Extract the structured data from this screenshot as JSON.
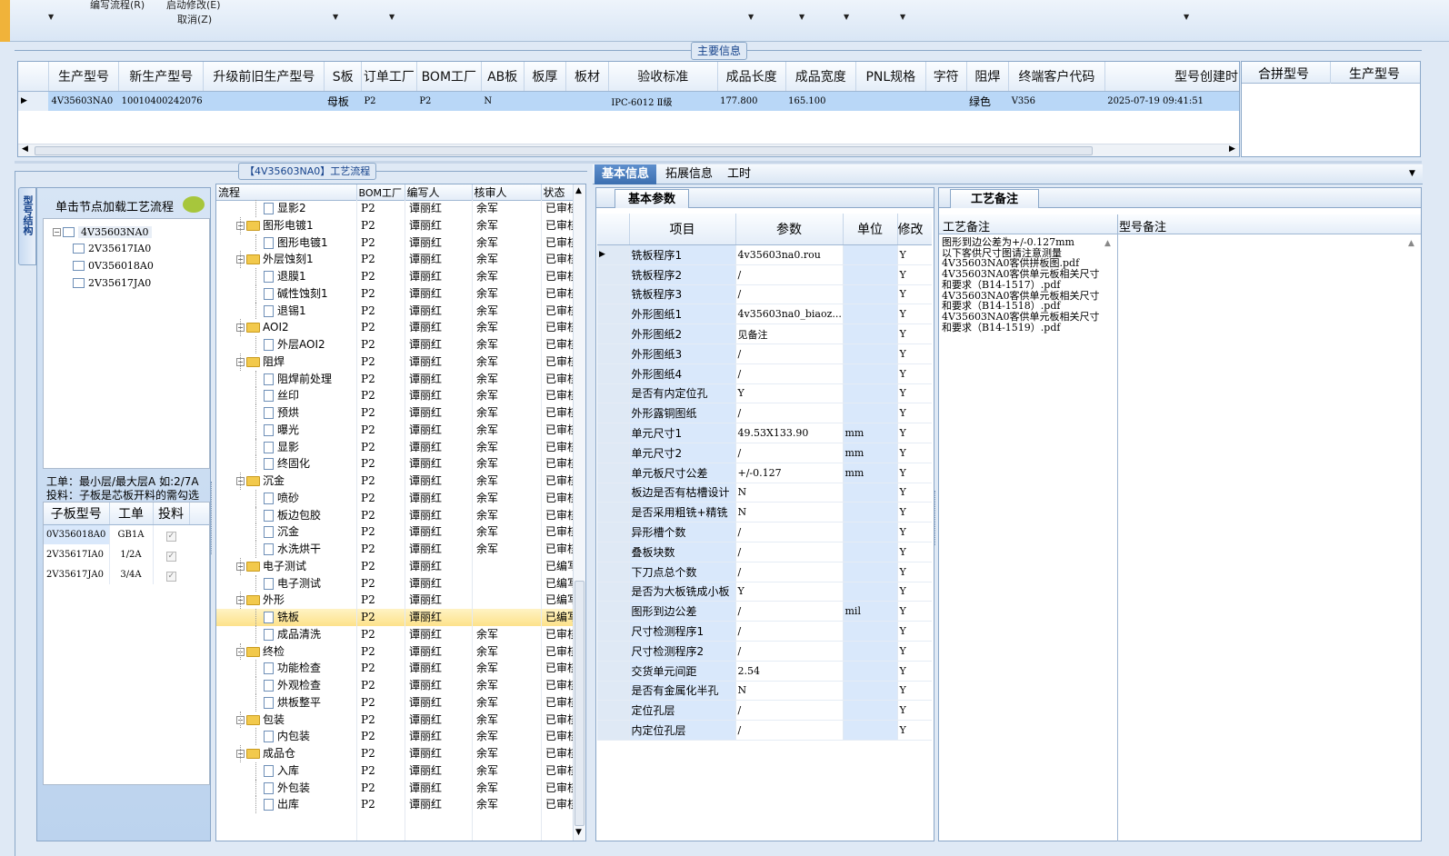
{
  "toolbar": {
    "item1": "编写流程(R)",
    "item2": "启动修改(E)",
    "item3": "取消(Z)"
  },
  "main_info": {
    "title": "主要信息",
    "columns": [
      "生产型号",
      "新生产型号",
      "升级前旧生产型号",
      "S板",
      "订单工厂",
      "BOM工厂",
      "AB板",
      "板厚",
      "板材",
      "验收标准",
      "成品长度",
      "成品宽度",
      "PNL规格",
      "字符",
      "阻焊",
      "终端客户代码",
      "型号创建时"
    ],
    "row": [
      "4V35603NA0",
      "10010400242076",
      "",
      "母板",
      "P2",
      "P2",
      "N",
      "",
      "",
      "IPC-6012 Ⅱ级",
      "177.800",
      "165.100",
      "",
      "",
      "绿色",
      "V356",
      "2025-07-19 09:41:51"
    ],
    "merge_columns": [
      "合拼型号",
      "生产型号"
    ]
  },
  "left_panel": {
    "side_tab": "型号结构",
    "load_hint": "单击节点加载工艺流程",
    "tree": {
      "root": "4V35603NA0",
      "children": [
        "2V35617IA0",
        "0V356018A0",
        "2V35617JA0"
      ]
    },
    "note1": "工单：最小层/最大层A 如:2/7A",
    "note2": "投料：子板是芯板开料的需勾选",
    "sub_columns": [
      "子板型号",
      "工单",
      "投料"
    ],
    "sub_rows": [
      [
        "0V356018A0",
        "GB1A",
        "✓"
      ],
      [
        "2V35617IA0",
        "1/2A",
        "✓"
      ],
      [
        "2V35617JA0",
        "3/4A",
        "✓"
      ]
    ]
  },
  "flow": {
    "title": "【4V35603NA0】工艺流程",
    "columns": [
      "流程",
      "BOM工厂",
      "编写人",
      "核审人",
      "状态"
    ],
    "rows": [
      {
        "level": 2,
        "name": "显影2",
        "bom": "P2",
        "writer": "谭丽红",
        "reviewer": "余军",
        "status": "已审核"
      },
      {
        "level": 1,
        "name": "图形电镀1",
        "bom": "P2",
        "writer": "谭丽红",
        "reviewer": "余军",
        "status": "已审核"
      },
      {
        "level": 2,
        "name": "图形电镀1",
        "bom": "P2",
        "writer": "谭丽红",
        "reviewer": "余军",
        "status": "已审核"
      },
      {
        "level": 1,
        "name": "外层蚀刻1",
        "bom": "P2",
        "writer": "谭丽红",
        "reviewer": "余军",
        "status": "已审核"
      },
      {
        "level": 2,
        "name": "退膜1",
        "bom": "P2",
        "writer": "谭丽红",
        "reviewer": "余军",
        "status": "已审核"
      },
      {
        "level": 2,
        "name": "碱性蚀刻1",
        "bom": "P2",
        "writer": "谭丽红",
        "reviewer": "余军",
        "status": "已审核"
      },
      {
        "level": 2,
        "name": "退锡1",
        "bom": "P2",
        "writer": "谭丽红",
        "reviewer": "余军",
        "status": "已审核"
      },
      {
        "level": 1,
        "name": "AOI2",
        "bom": "P2",
        "writer": "谭丽红",
        "reviewer": "余军",
        "status": "已审核"
      },
      {
        "level": 2,
        "name": "外层AOI2",
        "bom": "P2",
        "writer": "谭丽红",
        "reviewer": "余军",
        "status": "已审核"
      },
      {
        "level": 1,
        "name": "阻焊",
        "bom": "P2",
        "writer": "谭丽红",
        "reviewer": "余军",
        "status": "已审核"
      },
      {
        "level": 2,
        "name": "阻焊前处理",
        "bom": "P2",
        "writer": "谭丽红",
        "reviewer": "余军",
        "status": "已审核"
      },
      {
        "level": 2,
        "name": "丝印",
        "bom": "P2",
        "writer": "谭丽红",
        "reviewer": "余军",
        "status": "已审核"
      },
      {
        "level": 2,
        "name": "预烘",
        "bom": "P2",
        "writer": "谭丽红",
        "reviewer": "余军",
        "status": "已审核"
      },
      {
        "level": 2,
        "name": "曝光",
        "bom": "P2",
        "writer": "谭丽红",
        "reviewer": "余军",
        "status": "已审核"
      },
      {
        "level": 2,
        "name": "显影",
        "bom": "P2",
        "writer": "谭丽红",
        "reviewer": "余军",
        "status": "已审核"
      },
      {
        "level": 2,
        "name": "终固化",
        "bom": "P2",
        "writer": "谭丽红",
        "reviewer": "余军",
        "status": "已审核"
      },
      {
        "level": 1,
        "name": "沉金",
        "bom": "P2",
        "writer": "谭丽红",
        "reviewer": "余军",
        "status": "已审核"
      },
      {
        "level": 2,
        "name": "喷砂",
        "bom": "P2",
        "writer": "谭丽红",
        "reviewer": "余军",
        "status": "已审核"
      },
      {
        "level": 2,
        "name": "板边包胶",
        "bom": "P2",
        "writer": "谭丽红",
        "reviewer": "余军",
        "status": "已审核"
      },
      {
        "level": 2,
        "name": "沉金",
        "bom": "P2",
        "writer": "谭丽红",
        "reviewer": "余军",
        "status": "已审核"
      },
      {
        "level": 2,
        "name": "水洗烘干",
        "bom": "P2",
        "writer": "谭丽红",
        "reviewer": "余军",
        "status": "已审核"
      },
      {
        "level": 1,
        "name": "电子测试",
        "bom": "P2",
        "writer": "谭丽红",
        "reviewer": "",
        "status": "已编写"
      },
      {
        "level": 2,
        "name": "电子测试",
        "bom": "P2",
        "writer": "谭丽红",
        "reviewer": "",
        "status": "已编写"
      },
      {
        "level": 1,
        "name": "外形",
        "bom": "P2",
        "writer": "谭丽红",
        "reviewer": "",
        "status": "已编写"
      },
      {
        "level": 2,
        "name": "铣板",
        "bom": "P2",
        "writer": "谭丽红",
        "reviewer": "",
        "status": "已编写",
        "selected": true
      },
      {
        "level": 2,
        "name": "成品清洗",
        "bom": "P2",
        "writer": "谭丽红",
        "reviewer": "余军",
        "status": "已审核"
      },
      {
        "level": 1,
        "name": "终检",
        "bom": "P2",
        "writer": "谭丽红",
        "reviewer": "余军",
        "status": "已审核"
      },
      {
        "level": 2,
        "name": "功能检查",
        "bom": "P2",
        "writer": "谭丽红",
        "reviewer": "余军",
        "status": "已审核"
      },
      {
        "level": 2,
        "name": "外观检查",
        "bom": "P2",
        "writer": "谭丽红",
        "reviewer": "余军",
        "status": "已审核"
      },
      {
        "level": 2,
        "name": "烘板整平",
        "bom": "P2",
        "writer": "谭丽红",
        "reviewer": "余军",
        "status": "已审核"
      },
      {
        "level": 1,
        "name": "包装",
        "bom": "P2",
        "writer": "谭丽红",
        "reviewer": "余军",
        "status": "已审核"
      },
      {
        "level": 2,
        "name": "内包装",
        "bom": "P2",
        "writer": "谭丽红",
        "reviewer": "余军",
        "status": "已审核"
      },
      {
        "level": 1,
        "name": "成品仓",
        "bom": "P2",
        "writer": "谭丽红",
        "reviewer": "余军",
        "status": "已审核"
      },
      {
        "level": 2,
        "name": "入库",
        "bom": "P2",
        "writer": "谭丽红",
        "reviewer": "余军",
        "status": "已审核"
      },
      {
        "level": 2,
        "name": "外包装",
        "bom": "P2",
        "writer": "谭丽红",
        "reviewer": "余军",
        "status": "已审核"
      },
      {
        "level": 2,
        "name": "出库",
        "bom": "P2",
        "writer": "谭丽红",
        "reviewer": "余军",
        "status": "已审核"
      }
    ]
  },
  "tabs": [
    "基本信息",
    "拓展信息",
    "工时"
  ],
  "params": {
    "title": "基本参数",
    "columns": [
      "项目",
      "参数",
      "单位",
      "修改"
    ],
    "rows": [
      [
        "铣板程序1",
        "4v35603na0.rou",
        "",
        "Y"
      ],
      [
        "铣板程序2",
        "/",
        "",
        "Y"
      ],
      [
        "铣板程序3",
        "/",
        "",
        "Y"
      ],
      [
        "外形图纸1",
        "4v35603na0_biaoz...",
        "",
        "Y"
      ],
      [
        "外形图纸2",
        "见备注",
        "",
        "Y"
      ],
      [
        "外形图纸3",
        "/",
        "",
        "Y"
      ],
      [
        "外形图纸4",
        "/",
        "",
        "Y"
      ],
      [
        "是否有内定位孔",
        "Y",
        "",
        "Y"
      ],
      [
        "外形露铜图纸",
        "/",
        "",
        "Y"
      ],
      [
        "单元尺寸1",
        "49.53X133.90",
        "mm",
        "Y"
      ],
      [
        "单元尺寸2",
        "/",
        "mm",
        "Y"
      ],
      [
        "单元板尺寸公差",
        "+/-0.127",
        "mm",
        "Y"
      ],
      [
        "板边是否有枯槽设计",
        "N",
        "",
        "Y"
      ],
      [
        "是否采用粗铣+精铣",
        "N",
        "",
        "Y"
      ],
      [
        "异形槽个数",
        "/",
        "",
        "Y"
      ],
      [
        "叠板块数",
        "/",
        "",
        "Y"
      ],
      [
        "下刀点总个数",
        "/",
        "",
        "Y"
      ],
      [
        "是否为大板铣成小板",
        "Y",
        "",
        "Y"
      ],
      [
        "图形到边公差",
        "/",
        "mil",
        "Y"
      ],
      [
        "尺寸检测程序1",
        "/",
        "",
        "Y"
      ],
      [
        "尺寸检测程序2",
        "/",
        "",
        "Y"
      ],
      [
        "交货单元间距",
        "2.54",
        "",
        "Y"
      ],
      [
        "是否有金属化半孔",
        "N",
        "",
        "Y"
      ],
      [
        "定位孔层",
        "/",
        "",
        "Y"
      ],
      [
        "内定位孔层",
        "/",
        "",
        "Y"
      ]
    ]
  },
  "remarks": {
    "title": "工艺备注",
    "col1": "工艺备注",
    "col2": "型号备注",
    "lines": [
      "图形到边公差为+/-0.127mm",
      "以下客供尺寸图请注意测量",
      "4V35603NA0客供拼板图.pdf",
      "4V35603NA0客供单元板相关尺寸",
      "和要求（B14-1517）.pdf",
      "4V35603NA0客供单元板相关尺寸",
      "和要求（B14-1518）.pdf",
      "4V35603NA0客供单元板相关尺寸",
      "和要求（B14-1519）.pdf"
    ]
  }
}
